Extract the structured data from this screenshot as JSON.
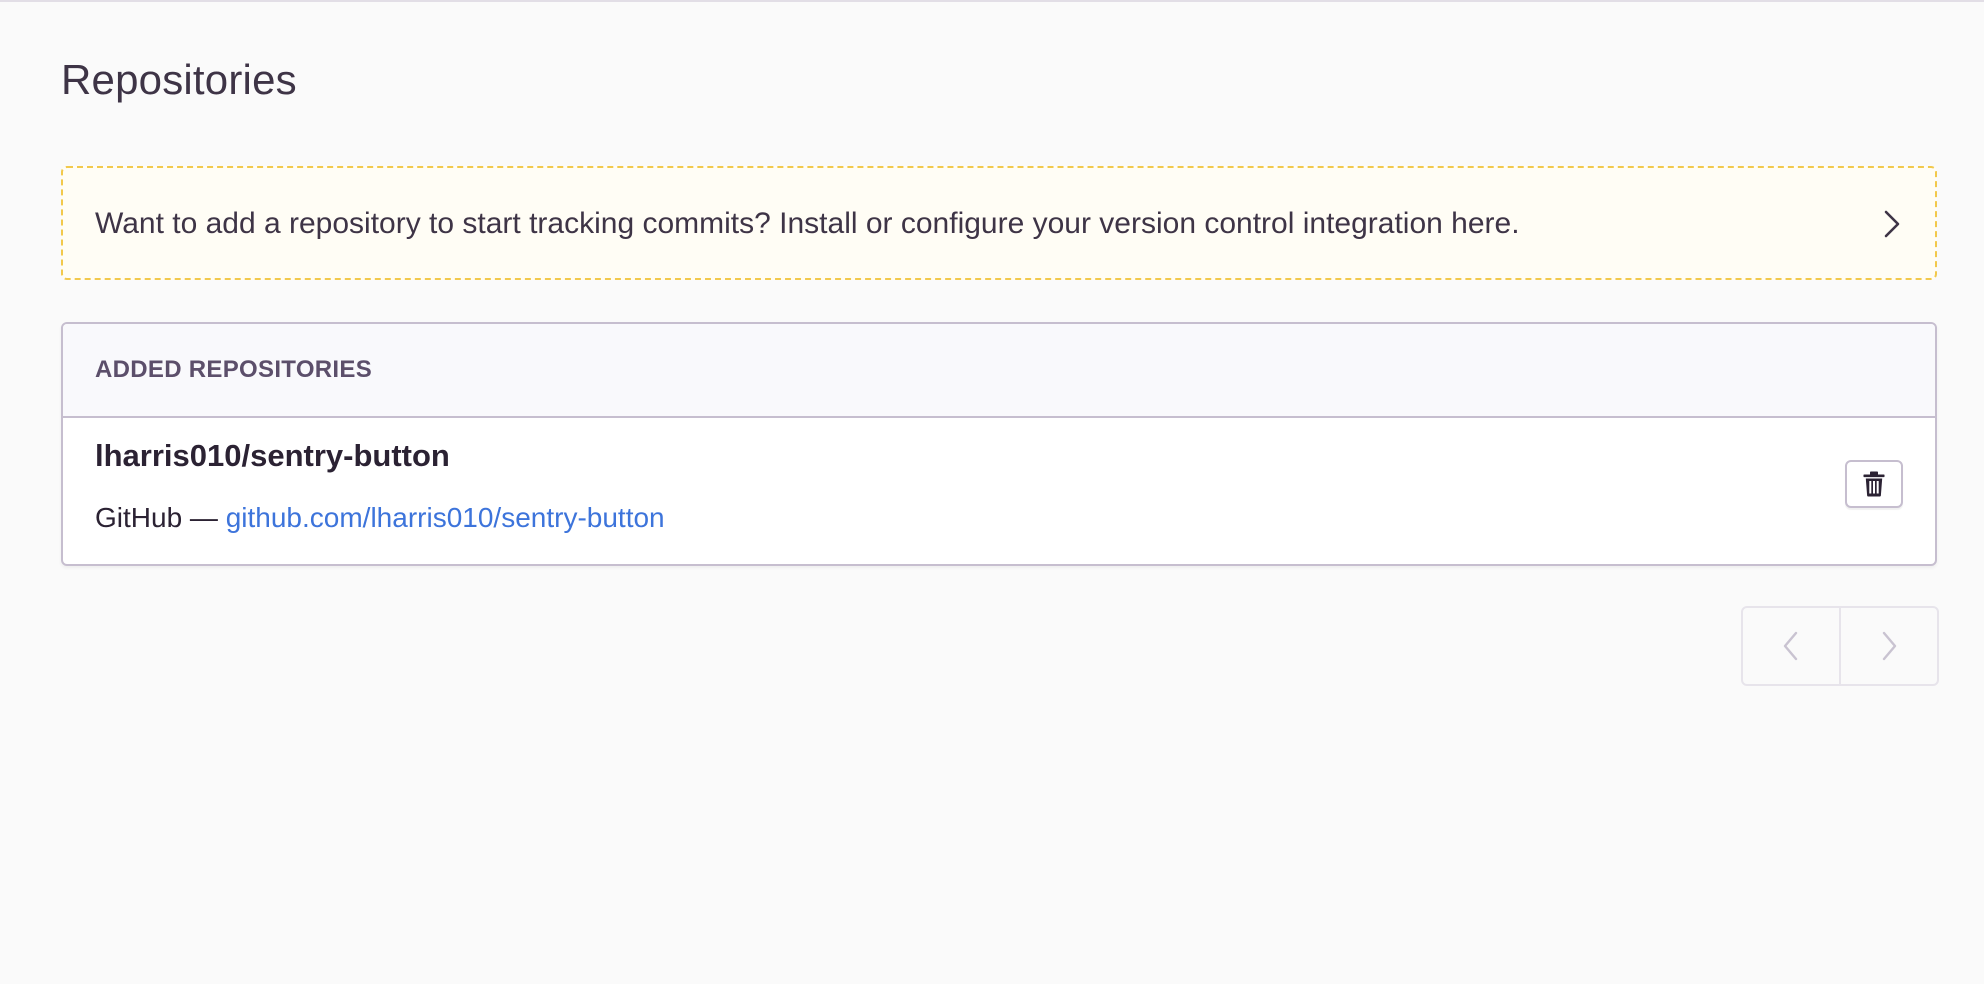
{
  "page": {
    "title": "Repositories"
  },
  "alert": {
    "text": "Want to add a repository to start tracking commits? Install or configure your version control integration here.",
    "icon": "chevron-right-icon"
  },
  "panel": {
    "header": "Added Repositories",
    "repositories": [
      {
        "name": "lharris010/sentry-button",
        "provider": "GitHub",
        "separator": " — ",
        "url_text": "github.com/lharris010/sentry-button",
        "delete_icon": "trash-icon"
      }
    ]
  },
  "pagination": {
    "prev_icon": "chevron-left-icon",
    "next_icon": "chevron-right-icon",
    "prev_disabled": true,
    "next_disabled": true
  },
  "colors": {
    "alert_border": "#f2c94c",
    "alert_background": "#fffdf5",
    "link": "#3d74db",
    "header_text": "#5c4f6b"
  }
}
